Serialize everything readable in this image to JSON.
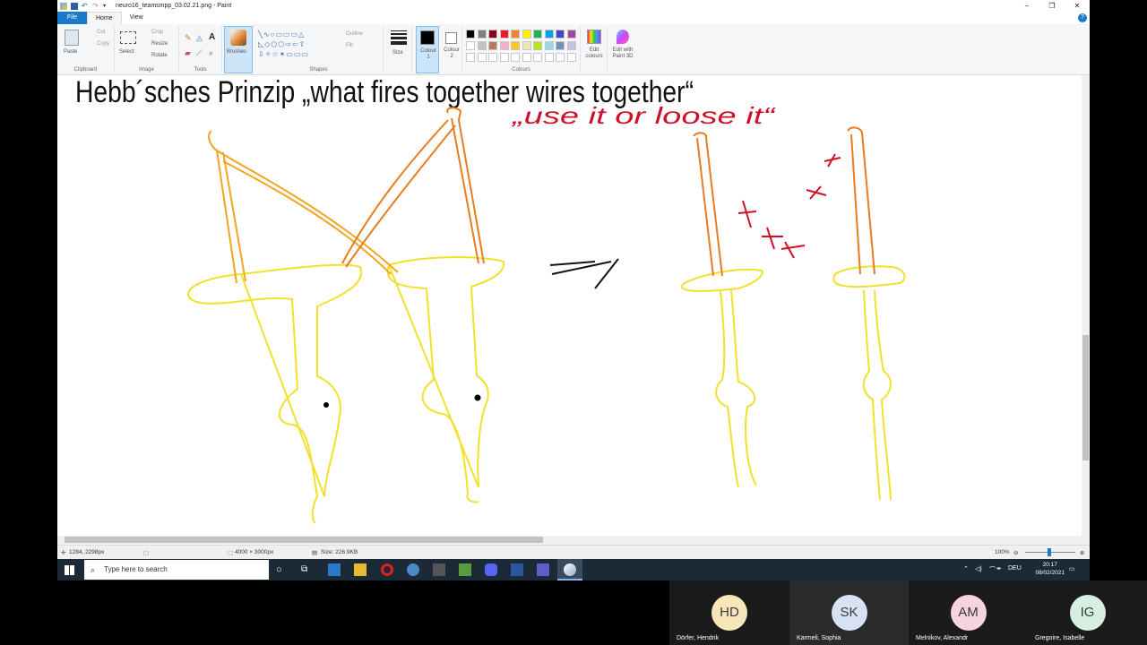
{
  "window": {
    "title": "neuro16_teamsmpp_03.02.21.png - Paint",
    "controls": [
      "–",
      "❐",
      "✕"
    ]
  },
  "tabs": [
    {
      "label": "File"
    },
    {
      "label": "Home"
    },
    {
      "label": "View"
    }
  ],
  "help_label": "?",
  "ribbon": {
    "clipboard": {
      "paste": "Paste",
      "cut": "Cut",
      "copy": "Copy",
      "label": "Clipboard"
    },
    "image": {
      "select": "Select",
      "crop": "Crop",
      "resize": "Resize",
      "rotate": "Rotate",
      "label": "Image"
    },
    "tools": {
      "label": "Tools"
    },
    "brushes": {
      "label": "Brushes"
    },
    "shapes": {
      "outline": "Outline",
      "fill": "Fill",
      "label": "Shapes"
    },
    "size": {
      "label": "Size"
    },
    "colour1": {
      "label": "Colour 1"
    },
    "colour2": {
      "label": "Colour 2"
    },
    "colours": {
      "label": "Colours",
      "row1": [
        "#000000",
        "#7f7f7f",
        "#880015",
        "#ed1c24",
        "#ff7f27",
        "#fff200",
        "#22b14c",
        "#00a2e8",
        "#3f48cc",
        "#a349a4"
      ],
      "row2": [
        "#ffffff",
        "#c3c3c3",
        "#b97a57",
        "#ffaec9",
        "#ffc90e",
        "#efe4b0",
        "#b5e61d",
        "#99d9ea",
        "#7092be",
        "#c8bfe7"
      ]
    },
    "edit_colours": "Edit colours",
    "edit_paint3d": "Edit with Paint 3D"
  },
  "canvas": {
    "heading": "Hebb´sches Prinzip „what fires together wires together“",
    "motto": "„use it or loose it“",
    "arrow_text": "=>"
  },
  "statusbar": {
    "cursor": "1284, 2298px",
    "dimensions": "4000 × 3000px",
    "size": "Size: 226.9KB",
    "zoom": "100%"
  },
  "taskbar": {
    "search_placeholder": "Type here to search",
    "language": "DEU",
    "time": "20:17",
    "date": "08/02/2021"
  },
  "participants": [
    {
      "initials": "HD",
      "name": "Dörfer, Hendrik",
      "color": "#f7e6b9"
    },
    {
      "initials": "SK",
      "name": "Karmeli, Sophia",
      "color": "#d8e2f2"
    },
    {
      "initials": "AM",
      "name": "Melnikov, Alexandr",
      "color": "#f6d3dd"
    },
    {
      "initials": "IG",
      "name": "Gregoire, Isabelle",
      "color": "#d7efe2"
    }
  ]
}
